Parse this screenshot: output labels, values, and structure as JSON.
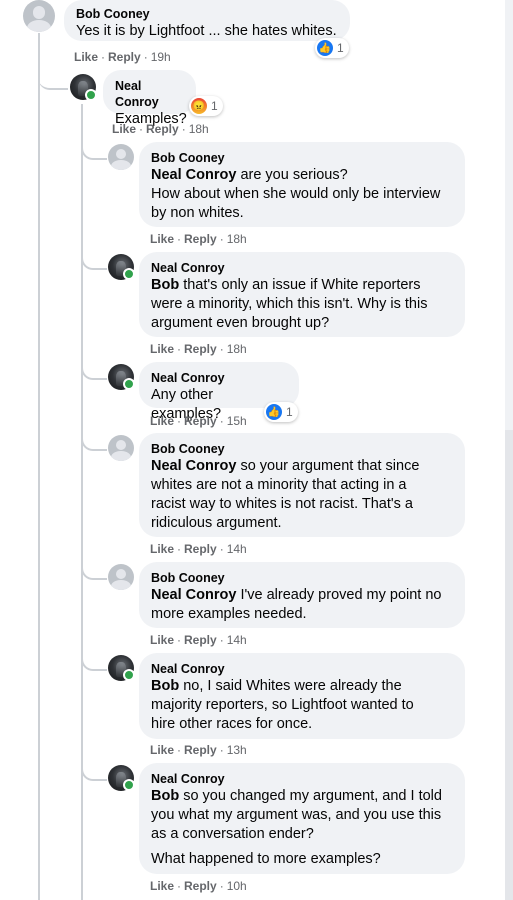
{
  "reactions": {
    "like_icon": "like-reaction-icon",
    "angry_icon": "angry-reaction-icon",
    "like_color": "#1877f2",
    "angry_color": "#e9710f"
  },
  "comments": [
    {
      "author": "Bob Cooney",
      "lines": [
        "Yes it is by Lightfoot ... she hates whites."
      ],
      "like": "Like",
      "reply": "Reply",
      "time": "19h",
      "reaction_count": "1"
    },
    {
      "author": "Neal Conroy",
      "lines": [
        "Examples?"
      ],
      "like": "Like",
      "reply": "Reply",
      "time": "18h",
      "reaction_count": "1"
    },
    {
      "author": "Bob Cooney",
      "mention": "Neal Conroy",
      "lines": [
        " are you serious?",
        "How about when she would only be interview",
        "by non whites."
      ],
      "like": "Like",
      "reply": "Reply",
      "time": "18h"
    },
    {
      "author": "Neal Conroy",
      "mention": "Bob",
      "lines": [
        " that's only an issue if White reporters",
        "were a minority, which this isn't. Why is this",
        "argument even brought up?"
      ],
      "like": "Like",
      "reply": "Reply",
      "time": "18h"
    },
    {
      "author": "Neal Conroy",
      "lines": [
        "Any other examples?"
      ],
      "like": "Like",
      "reply": "Reply",
      "time": "15h",
      "reaction_count": "1"
    },
    {
      "author": "Bob Cooney",
      "mention": "Neal Conroy",
      "lines": [
        " so your argument that since",
        "whites are not a minority that acting in a",
        "racist way to whites is not racist. That's a",
        "ridiculous argument."
      ],
      "like": "Like",
      "reply": "Reply",
      "time": "14h"
    },
    {
      "author": "Bob Cooney",
      "mention": "Neal Conroy",
      "lines": [
        " I've already proved my point no",
        "more examples needed."
      ],
      "like": "Like",
      "reply": "Reply",
      "time": "14h"
    },
    {
      "author": "Neal Conroy",
      "mention": "Bob",
      "lines": [
        " no, I said Whites were already the",
        "majority reporters, so Lightfoot wanted to",
        "hire other races for once."
      ],
      "like": "Like",
      "reply": "Reply",
      "time": "13h"
    },
    {
      "author": "Neal Conroy",
      "mention": "Bob",
      "lines": [
        " so you changed my argument, and I told",
        "you what my argument was, and you use this",
        "as a conversation ender?",
        "What happened to more examples?"
      ],
      "like": "Like",
      "reply": "Reply",
      "time": "10h"
    }
  ]
}
